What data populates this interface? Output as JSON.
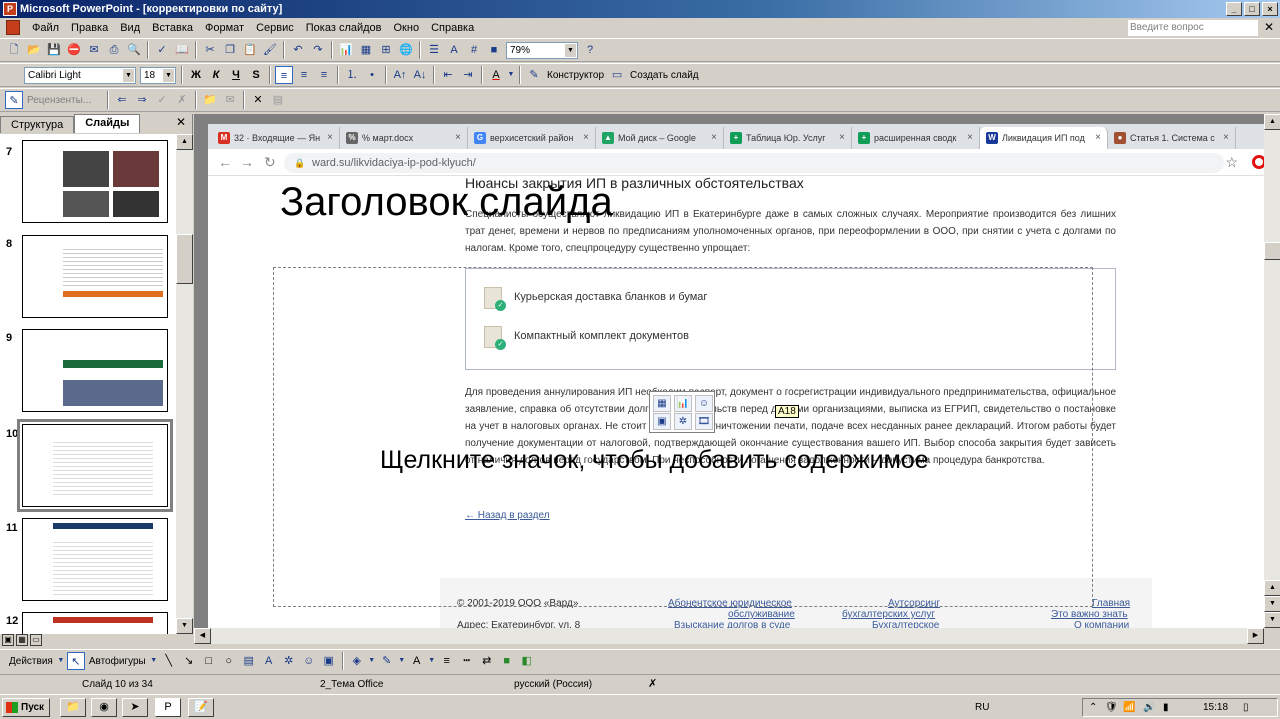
{
  "window": {
    "title": "Microsoft PowerPoint - [корректировки по сайту]"
  },
  "menu": {
    "items": [
      "Файл",
      "Правка",
      "Вид",
      "Вставка",
      "Формат",
      "Сервис",
      "Показ слайдов",
      "Окно",
      "Справка"
    ],
    "ask_placeholder": "Введите вопрос"
  },
  "toolbar_standard": {
    "zoom": "79%"
  },
  "toolbar_format": {
    "font": "Calibri Light",
    "size": "18",
    "bold": "Ж",
    "italic": "К",
    "underline": "Ч",
    "shadow": "S",
    "designer": "Конструктор",
    "create_slide": "Создать слайд"
  },
  "toolbar_review": {
    "reviewers": "Рецензенты..."
  },
  "panel": {
    "tabs": [
      "Структура",
      "Слайды"
    ],
    "active_tab": "Слайды",
    "thumbs": [
      {
        "num": "7"
      },
      {
        "num": "8"
      },
      {
        "num": "9"
      },
      {
        "num": "10"
      },
      {
        "num": "11"
      },
      {
        "num": "12"
      }
    ],
    "selected": "10"
  },
  "browser": {
    "tabs": [
      {
        "label": "32 · Входящие — Ян",
        "color": "#d93025",
        "icon": "M"
      },
      {
        "label": "% март.docx",
        "color": "#666666",
        "icon": "%"
      },
      {
        "label": "верхисетский район",
        "color": "#4285f4",
        "icon": "G"
      },
      {
        "label": "Мой диск – Google",
        "color": "#1fa463",
        "icon": "▲"
      },
      {
        "label": "Таблица Юр. Услуг",
        "color": "#0f9d58",
        "icon": "+"
      },
      {
        "label": "расширенная сводк",
        "color": "#0f9d58",
        "icon": "+"
      },
      {
        "label": "Ликвидация ИП под",
        "color": "#1a3a9a",
        "icon": "W"
      },
      {
        "label": "Статья 1. Система с",
        "color": "#a05030",
        "icon": "●"
      }
    ],
    "url": "ward.su/likvidaciya-ip-pod-klyuch/"
  },
  "webpage": {
    "heading": "Нюансы закрытия ИП в различных обстоятельствах",
    "para1": "Специалисты осуществляют ликвидацию ИП в Екатеринбурге даже в самых сложных случаях. Мероприятие производится без лишних трат денег, времени и нервов по предписаниям уполномоченных органов, при переоформлении в ООО, при снятии с учета с долгами по налогам. Кроме того, спецпроцедуру существенно упрощает:",
    "list": [
      "Курьерская доставка бланков и бумаг",
      "Компактный комплект документов"
    ],
    "para2": "Для проведения аннулирования ИП необходим паспорт, документ о госрегистрации индивидуального предпринимательства, официальное заявление, справка об отсутствии долговых обязательств перед другими организациями, выписка из ЕГРИП, свидетельство о постановке на учет в налоговых органах. Не стоит забывать об уничтожении печати, подаче всех несданных ранее деклараций. Итогом работы будет получение документации от налоговой, подтверждающей окончание существования вашего ИП. Выбор способа закрытия будет зависеть от наличия долгов перед государством. При неспособности погашения задолженности – допустима процедура банкротства.",
    "back": "← Назад в раздел",
    "footer": {
      "copyright": "© 2001-2019 ООО «Вард»",
      "address": "Адрес: Екатеринбург, ул. 8",
      "col2": [
        "Абонентское юридическое",
        "обслуживание",
        "Взыскание долгов в суде"
      ],
      "col3": [
        "Аутсорсинг",
        "бухгалтерских услуг",
        "Бухгалтерское"
      ],
      "col4": [
        "Главная",
        "Это важно знать",
        "О компании"
      ]
    }
  },
  "slide": {
    "title": "Заголовок слайда",
    "placeholder": "Щелкните значок, чтобы добавить содержимое",
    "tooltip": "A18"
  },
  "drawing": {
    "actions": "Действия",
    "autoshapes": "Автофигуры"
  },
  "status": {
    "slide": "Слайд 10 из 34",
    "theme": "2_Тема Office",
    "language": "русский (Россия)"
  },
  "taskbar": {
    "start": "Пуск",
    "lang": "RU",
    "time": "15:18"
  }
}
